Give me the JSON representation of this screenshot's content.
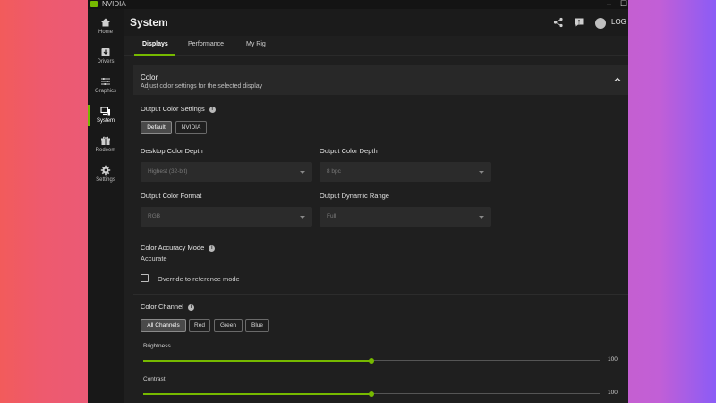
{
  "window": {
    "app_name": "NVIDIA",
    "minimize": "–",
    "maximize": "☐"
  },
  "sidebar": {
    "items": [
      {
        "label": "Home",
        "icon": "home-icon"
      },
      {
        "label": "Drivers",
        "icon": "drivers-icon"
      },
      {
        "label": "Graphics",
        "icon": "graphics-icon"
      },
      {
        "label": "System",
        "icon": "system-icon",
        "active": true
      },
      {
        "label": "Redeem",
        "icon": "redeem-icon"
      },
      {
        "label": "Settings",
        "icon": "settings-icon"
      }
    ]
  },
  "header": {
    "title": "System",
    "login_label": "LOG IN"
  },
  "tabs": [
    {
      "label": "Displays",
      "active": true
    },
    {
      "label": "Performance"
    },
    {
      "label": "My Rig"
    }
  ],
  "color_section": {
    "title": "Color",
    "subtitle": "Adjust color settings for the selected display"
  },
  "output_color_settings": {
    "label": "Output Color Settings",
    "options": [
      "Default",
      "NVIDIA"
    ],
    "selected": "Default"
  },
  "desktop_color_depth": {
    "label": "Desktop Color Depth",
    "value": "Highest (32-bit)"
  },
  "output_color_depth": {
    "label": "Output Color Depth",
    "value": "8 bpc"
  },
  "output_color_format": {
    "label": "Output Color Format",
    "value": "RGB"
  },
  "output_dynamic_range": {
    "label": "Output Dynamic Range",
    "value": "Full"
  },
  "color_accuracy": {
    "label": "Color Accuracy Mode",
    "value": "Accurate",
    "override_label": "Override to reference mode",
    "override_checked": false
  },
  "color_channel": {
    "label": "Color Channel",
    "options": [
      "All Channels",
      "Red",
      "Green",
      "Blue"
    ],
    "selected": "All Channels"
  },
  "brightness": {
    "label": "Brightness",
    "value": "100",
    "position": 0.5
  },
  "contrast": {
    "label": "Contrast",
    "value": "100",
    "position": 0.5
  },
  "colors": {
    "accent": "#76b900",
    "background": "#1f1f1f",
    "sidebar": "#181818"
  }
}
